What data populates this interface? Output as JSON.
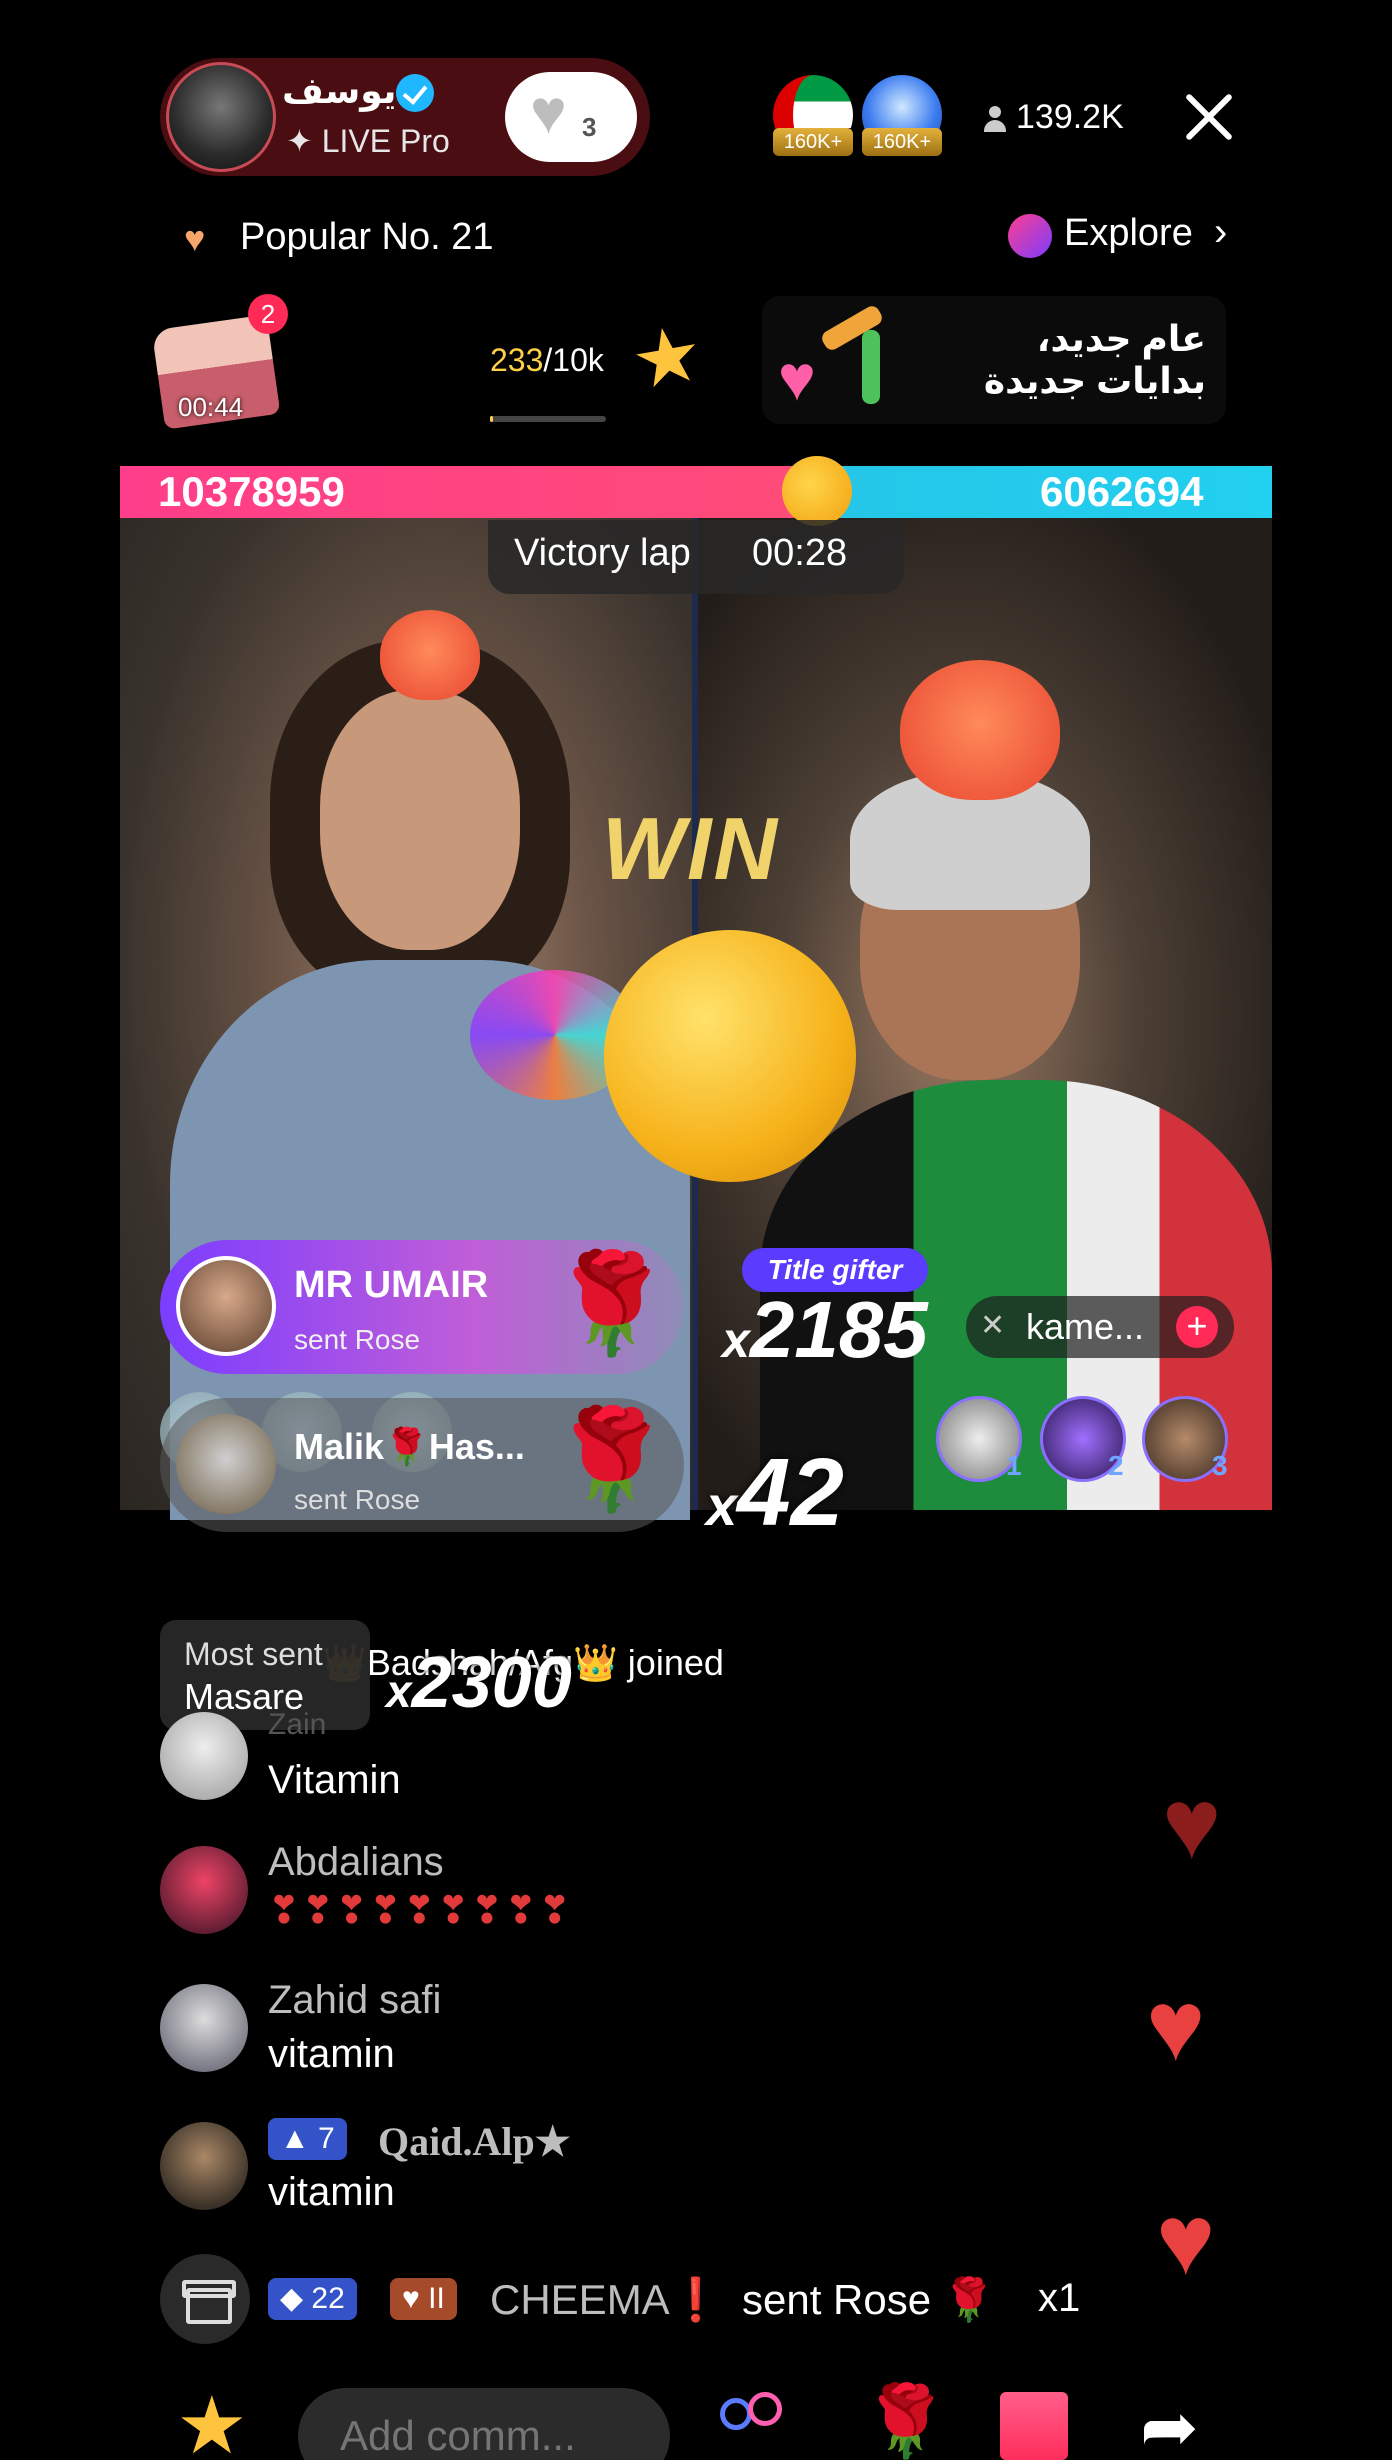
{
  "header": {
    "host_name": "يوسف",
    "host_subtitle": "✦ LIVE Pro",
    "follow_count": "3",
    "badges": [
      "160K+",
      "160K+"
    ],
    "viewer_count": "139.2K"
  },
  "row2": {
    "popular": "Popular No. 21",
    "explore": "Explore"
  },
  "row3": {
    "chest_badge": "2",
    "chest_timer": "00:44",
    "progress_current": "233",
    "progress_total": "/10k",
    "promo_line1": "عام جديد،",
    "promo_line2": "بدايات جديدة"
  },
  "battle": {
    "score_left": "10378959",
    "score_right": "6062694",
    "victory_label": "Victory lap",
    "victory_time": "00:28",
    "win_text": "WIN"
  },
  "gifts": {
    "gift1_name": "MR UMAIR",
    "gift1_action": "sent Rose",
    "gift2_name": "Malik🌹Has...",
    "gift2_action": "sent Rose",
    "combo_left_x": "x",
    "combo_left": "42",
    "title_gifter": "Title gifter",
    "combo_right_x": "x",
    "combo_right": "2185",
    "right_name": "kame...",
    "ranks": [
      "1",
      "2",
      "3"
    ]
  },
  "chat": {
    "most_sent_label": "Most sent",
    "most_sent_name": "Masare",
    "joined_text": "👑Badshah/Afg👑 joined",
    "combo_x": "x",
    "combo": "2300",
    "messages": [
      {
        "user": "Zain",
        "text": "Vitamin"
      },
      {
        "user": "Abdalians",
        "text": "❣❣❣❣❣❣❣❣❣"
      },
      {
        "user": "Zahid safi",
        "text": "vitamin"
      },
      {
        "user": "Qaid.Alp★",
        "badge": "7",
        "text": "vitamin"
      }
    ],
    "gift_line": {
      "badge_level": "22",
      "badge_fan": "II",
      "user": "CHEEMA❗",
      "action": "sent Rose 🌹",
      "count": "x1"
    }
  },
  "bottom": {
    "comment_placeholder": "Add comm..."
  }
}
